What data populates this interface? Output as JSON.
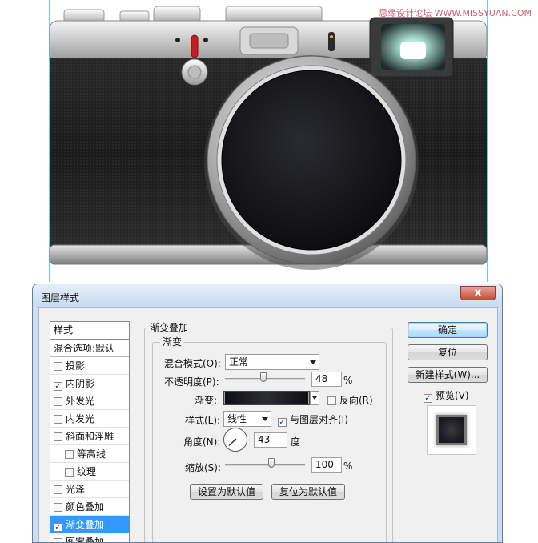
{
  "watermark": "思缘设计论坛 WWW.MISSYUAN.COM",
  "colors": {
    "accent": "#3399ff",
    "dialog_frame": "#5d7fa6",
    "close_red": "#c94a37",
    "gradient_dark": "#0e0e12"
  },
  "dialog": {
    "title": "图层样式",
    "close_label": "x"
  },
  "styles_panel": {
    "header": "样式",
    "items": [
      {
        "label": "混合选项:默认",
        "checkbox": false,
        "checked": false
      },
      {
        "label": "投影",
        "checkbox": true,
        "checked": false
      },
      {
        "label": "内阴影",
        "checkbox": true,
        "checked": true
      },
      {
        "label": "外发光",
        "checkbox": true,
        "checked": false
      },
      {
        "label": "内发光",
        "checkbox": true,
        "checked": false
      },
      {
        "label": "斜面和浮雕",
        "checkbox": true,
        "checked": false
      },
      {
        "label": "等高线",
        "checkbox": true,
        "checked": false
      },
      {
        "label": "纹理",
        "checkbox": true,
        "checked": false
      },
      {
        "label": "光泽",
        "checkbox": true,
        "checked": false
      },
      {
        "label": "颜色叠加",
        "checkbox": true,
        "checked": false
      },
      {
        "label": "渐变叠加",
        "checkbox": true,
        "checked": true
      },
      {
        "label": "图案叠加",
        "checkbox": true,
        "checked": false
      }
    ]
  },
  "gradient_overlay": {
    "section_title": "渐变叠加",
    "group_title": "渐变",
    "blend_mode_label": "混合模式(O):",
    "blend_mode_value": "正常",
    "opacity_label": "不透明度(P):",
    "opacity_value": "48",
    "opacity_fraction": 0.48,
    "percent": "%",
    "gradient_label": "渐变:",
    "reverse_label": "反向(R)",
    "style_label": "样式(L):",
    "style_value": "线性",
    "align_label": "与图层对齐(I)",
    "angle_label": "角度(N):",
    "angle_value": "43",
    "degree_unit": "度",
    "scale_label": "缩放(S):",
    "scale_value": "100",
    "scale_fraction": 0.5,
    "set_default_button": "设置为默认值",
    "reset_default_button": "复位为默认值"
  },
  "actions": {
    "ok": "确定",
    "reset": "复位",
    "new_style": "新建样式(W)...",
    "preview_label": "预览(V)"
  }
}
